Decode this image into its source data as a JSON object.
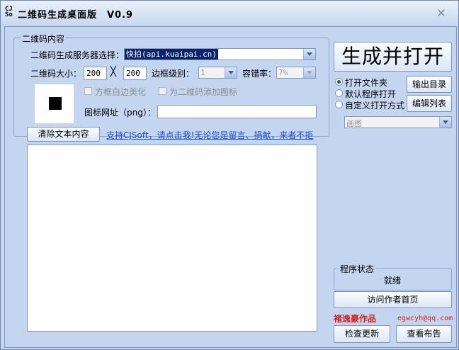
{
  "window": {
    "title": "二维码生成桌面版　V0.9",
    "app_icon_text": "CJS\nsoft"
  },
  "content_group": {
    "legend": "二维码内容",
    "server_label": "二维码生成服务器选择：",
    "server_value": "快拍(api.kuaipai.cn)",
    "size_label": "二维码大小：",
    "size_width": "200",
    "size_times": "╳",
    "size_height": "200",
    "border_label": "边框级别：",
    "border_value": "1",
    "ecc_label": "容错率：",
    "ecc_value": "7%",
    "beautify_label": "方框白边美化",
    "add_icon_label": "为二维码添加图标",
    "icon_url_label": "图标网址（png）：",
    "icon_url_value": ""
  },
  "clear_button": "清除文本内容",
  "support_link": "支持CJSoft，请点击我!无论您是留言、捐献，来者不拒",
  "text_content": "",
  "right_panel": {
    "generate_button": "生成并打开",
    "radio_open_folder": "打开文件夹",
    "radio_default_program": "默认程序打开",
    "radio_custom": "自定义打开方式",
    "selected_radio": "open_folder",
    "output_dir_button": "输出目录",
    "edit_list_button": "编辑列表",
    "program_select": "画图",
    "status_legend": "程序状态",
    "status_value": "就绪",
    "visit_button": "访问作者首页",
    "author": "褚逸豪作品",
    "email": "egwcyh@qq.com",
    "check_update_button": "检查更新",
    "view_notice_button": "查看布告"
  },
  "colors": {
    "background": "#c4d6ef",
    "selection": "#0a246a",
    "link": "#1a4ed0",
    "author_red": "#d42020"
  }
}
